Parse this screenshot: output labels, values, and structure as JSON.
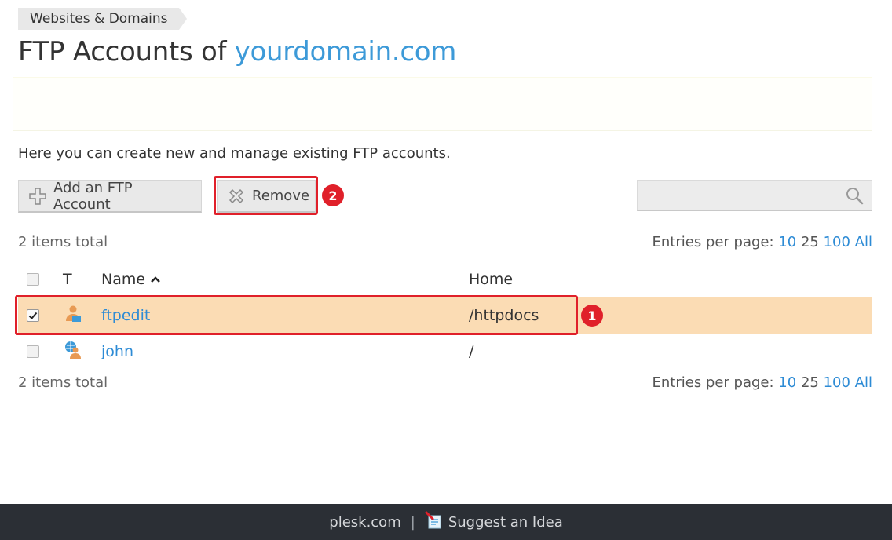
{
  "breadcrumb": {
    "label": "Websites & Domains"
  },
  "title": {
    "prefix": "FTP Accounts of ",
    "domain": "yourdomain.com"
  },
  "intro": "Here you can create new and manage existing FTP accounts.",
  "toolbar": {
    "add_label": "Add an FTP Account",
    "add_icon": "plus-icon",
    "remove_label": "Remove",
    "remove_icon": "remove-x-icon",
    "search_placeholder": "",
    "search_icon": "magnifier-icon"
  },
  "annotations": {
    "remove_badge": "2",
    "row_badge": "1",
    "color": "#e0202a"
  },
  "list": {
    "total_label": "2 items total",
    "entries_label": "Entries per page:",
    "page_sizes": [
      "10",
      "25",
      "100",
      "All"
    ],
    "current_page_size": "25",
    "columns": {
      "type": "T",
      "name": "Name",
      "home": "Home"
    },
    "sort": {
      "column": "Name",
      "direction": "ascending"
    },
    "rows": [
      {
        "name": "ftpedit",
        "home": "/httpdocs",
        "selected": true,
        "icon": "ftp-user-icon"
      },
      {
        "name": "john",
        "home": "/",
        "selected": false,
        "icon": "ftp-user-globe-icon"
      }
    ]
  },
  "footer": {
    "link": "plesk.com",
    "separator": "|",
    "idea_label": "Suggest an Idea",
    "idea_icon": "suggest-idea-icon",
    "background": "#2b2f35"
  },
  "colors": {
    "accent_link": "#2d8bd5",
    "selected_row": "#fbdcb4"
  }
}
